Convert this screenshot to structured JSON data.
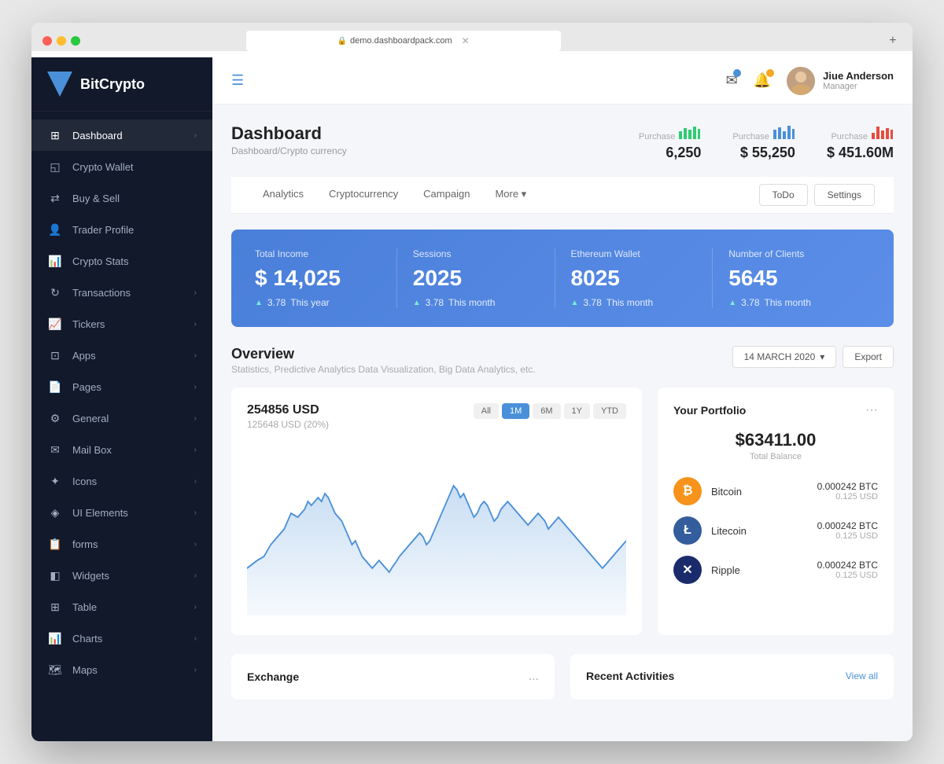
{
  "browser": {
    "url": "demo.dashboardpack.com",
    "new_tab_label": "+"
  },
  "sidebar": {
    "logo": {
      "text": "BitCrypto"
    },
    "items": [
      {
        "id": "dashboard",
        "label": "Dashboard",
        "icon": "⊞",
        "hasChevron": true,
        "active": true
      },
      {
        "id": "crypto-wallet",
        "label": "Crypto Wallet",
        "icon": "◱",
        "hasChevron": false
      },
      {
        "id": "buy-sell",
        "label": "Buy & Sell",
        "icon": "⇄",
        "hasChevron": false
      },
      {
        "id": "trader-profile",
        "label": "Trader Profile",
        "icon": "👤",
        "hasChevron": false
      },
      {
        "id": "crypto-stats",
        "label": "Crypto Stats",
        "icon": "📊",
        "hasChevron": false
      },
      {
        "id": "transactions",
        "label": "Transactions",
        "icon": "↻",
        "hasChevron": true
      },
      {
        "id": "tickers",
        "label": "Tickers",
        "icon": "📈",
        "hasChevron": true
      },
      {
        "id": "apps",
        "label": "Apps",
        "icon": "⊡",
        "hasChevron": true
      },
      {
        "id": "pages",
        "label": "Pages",
        "icon": "📄",
        "hasChevron": true
      },
      {
        "id": "general",
        "label": "General",
        "icon": "⚙",
        "hasChevron": true
      },
      {
        "id": "mail-box",
        "label": "Mail Box",
        "icon": "✉",
        "hasChevron": true
      },
      {
        "id": "icons",
        "label": "Icons",
        "icon": "✦",
        "hasChevron": true
      },
      {
        "id": "ui-elements",
        "label": "UI Elements",
        "icon": "◈",
        "hasChevron": true
      },
      {
        "id": "forms",
        "label": "forms",
        "icon": "📋",
        "hasChevron": true
      },
      {
        "id": "widgets",
        "label": "Widgets",
        "icon": "◧",
        "hasChevron": true
      },
      {
        "id": "table",
        "label": "Table",
        "icon": "⊞",
        "hasChevron": true
      },
      {
        "id": "charts",
        "label": "Charts",
        "icon": "📊",
        "hasChevron": true
      },
      {
        "id": "maps",
        "label": "Maps",
        "icon": "🗺",
        "hasChevron": true
      }
    ]
  },
  "topbar": {
    "hamburger_label": "☰",
    "user": {
      "name": "Jiue Anderson",
      "role": "Manager"
    }
  },
  "page_header": {
    "title": "Dashboard",
    "breadcrumb": "Dashboard/Crypto currency",
    "stats": [
      {
        "label": "Purchase",
        "value": "6,250",
        "icon_color": "green"
      },
      {
        "label": "Purchase",
        "value": "$ 55,250",
        "icon_color": "blue"
      },
      {
        "label": "Purchase",
        "value": "$ 451.60M",
        "icon_color": "red"
      }
    ]
  },
  "tabs": {
    "left": [
      {
        "label": "Analytics",
        "active": false
      },
      {
        "label": "Cryptocurrency",
        "active": false
      },
      {
        "label": "Campaign",
        "active": false
      },
      {
        "label": "More ▾",
        "active": false
      }
    ],
    "right": [
      {
        "label": "ToDo"
      },
      {
        "label": "Settings"
      }
    ]
  },
  "stats_banner": {
    "items": [
      {
        "label": "Total Income",
        "value": "$ 14,025",
        "sub_num": "3.78",
        "sub_text": "This year"
      },
      {
        "label": "Sessions",
        "value": "2025",
        "sub_num": "3.78",
        "sub_text": "This month"
      },
      {
        "label": "Ethereum Wallet",
        "value": "8025",
        "sub_num": "3.78",
        "sub_text": "This month"
      },
      {
        "label": "Number of Clients",
        "value": "5645",
        "sub_num": "3.78",
        "sub_text": "This month"
      }
    ]
  },
  "overview": {
    "title": "Overview",
    "subtitle": "Statistics, Predictive Analytics Data Visualization, Big Data Analytics, etc.",
    "date": "14 MARCH 2020",
    "export_label": "Export",
    "chart": {
      "value": "254856 USD",
      "sub": "125648 USD (20%)",
      "filters": [
        "All",
        "1M",
        "6M",
        "1Y",
        "YTD"
      ],
      "active_filter": "1M"
    }
  },
  "portfolio": {
    "title": "Your Portfolio",
    "balance": "$63411.00",
    "balance_label": "Total Balance",
    "cryptos": [
      {
        "name": "Bitcoin",
        "icon_class": "icon-btc",
        "symbol": "₿",
        "btc": "0.000242 BTC",
        "usd": "0.125 USD"
      },
      {
        "name": "Litecoin",
        "icon_class": "icon-ltc",
        "symbol": "Ł",
        "btc": "0.000242 BTC",
        "usd": "0.125 USD"
      },
      {
        "name": "Ripple",
        "icon_class": "icon-xrp",
        "symbol": "✕",
        "btc": "0.000242 BTC",
        "usd": "0.125 USD"
      }
    ]
  },
  "bottom": {
    "exchange_title": "Exchange",
    "activities_title": "Recent Activities",
    "view_all": "View all",
    "dots": "..."
  }
}
